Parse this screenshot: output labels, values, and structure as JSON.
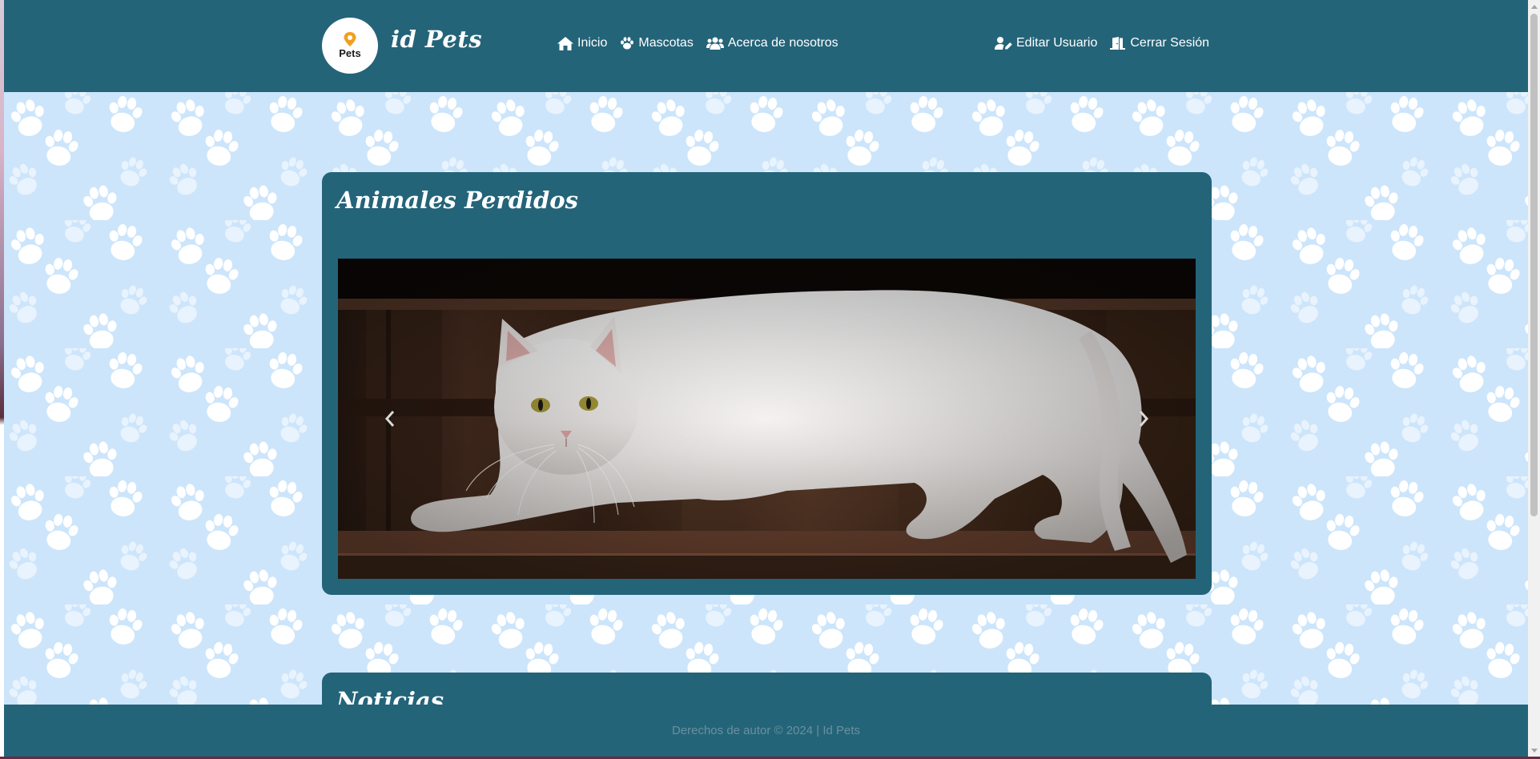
{
  "header": {
    "logo_text": "Pets",
    "brand": "id Pets",
    "nav": [
      {
        "label": "Inicio",
        "icon": "home-icon"
      },
      {
        "label": "Mascotas",
        "icon": "paw-icon"
      },
      {
        "label": "Acerca de nosotros",
        "icon": "users-icon"
      }
    ],
    "user_nav": [
      {
        "label": "Editar Usuario",
        "icon": "user-edit-icon"
      },
      {
        "label": "Cerrar Sesión",
        "icon": "door-open-icon"
      }
    ]
  },
  "sections": {
    "lost": {
      "title": "Animales Perdidos",
      "carousel": {
        "image": "white-cat-on-wooden-pallet",
        "prev_icon": "chevron-left-icon",
        "next_icon": "chevron-right-icon"
      }
    },
    "news": {
      "title": "Noticias"
    }
  },
  "footer": {
    "text": "Derechos de autor © 2024 | Id Pets"
  },
  "colors": {
    "primary": "#246479",
    "page_background": "#cce5fb",
    "paw_pattern": "#ffffff",
    "footer_text": "#6b8f9f",
    "logo_accent": "#f0a020"
  }
}
